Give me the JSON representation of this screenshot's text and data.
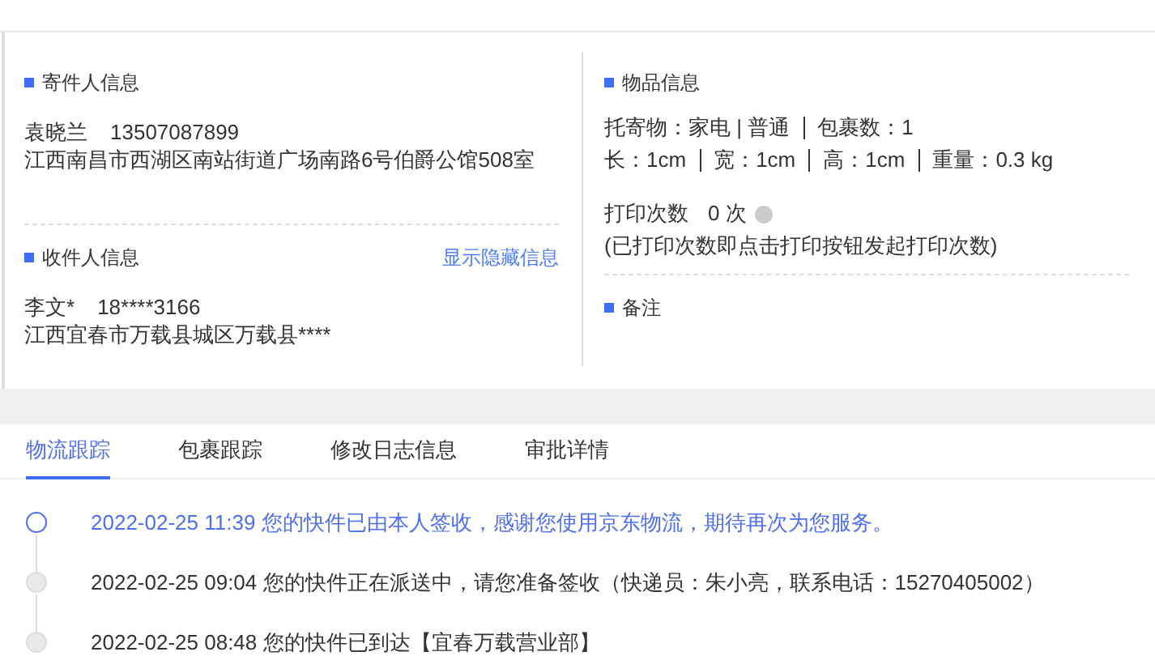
{
  "sender": {
    "title": "寄件人信息",
    "name": "袁晓兰",
    "phone": "13507087899",
    "address": "江西南昌市西湖区南站街道广场南路6号伯爵公馆508室"
  },
  "recipient": {
    "title": "收件人信息",
    "link": "显示隐藏信息",
    "name": "李文*",
    "phone": "18****3166",
    "address": "江西宜春市万载县城区万载县****"
  },
  "goods": {
    "title": "物品信息",
    "line1": [
      "托寄物：家电 | 普通",
      "包裹数：1"
    ],
    "line2": [
      "长：1cm",
      "宽：1cm",
      "高：1cm",
      "重量：0.3 kg"
    ],
    "print_label": "打印次数",
    "print_count": "0 次",
    "print_note": "(已打印次数即点击打印按钮发起打印次数)"
  },
  "remark": {
    "title": "备注"
  },
  "tabs": [
    {
      "label": "物流跟踪",
      "selected": true
    },
    {
      "label": "包裹跟踪",
      "selected": false
    },
    {
      "label": "修改日志信息",
      "selected": false
    },
    {
      "label": "审批详情",
      "selected": false
    }
  ],
  "timeline": [
    {
      "time": "2022-02-25 11:39",
      "text": "您的快件已由本人签收，感谢您使用京东物流，期待再次为您服务。",
      "current": true
    },
    {
      "time": "2022-02-25 09:04",
      "text": "您的快件正在派送中，请您准备签收（快递员：朱小亮，联系电话：15270405002）",
      "current": false
    },
    {
      "time": "2022-02-25 08:48",
      "text": "您的快件已到达【宜春万载营业部】",
      "current": false
    }
  ]
}
